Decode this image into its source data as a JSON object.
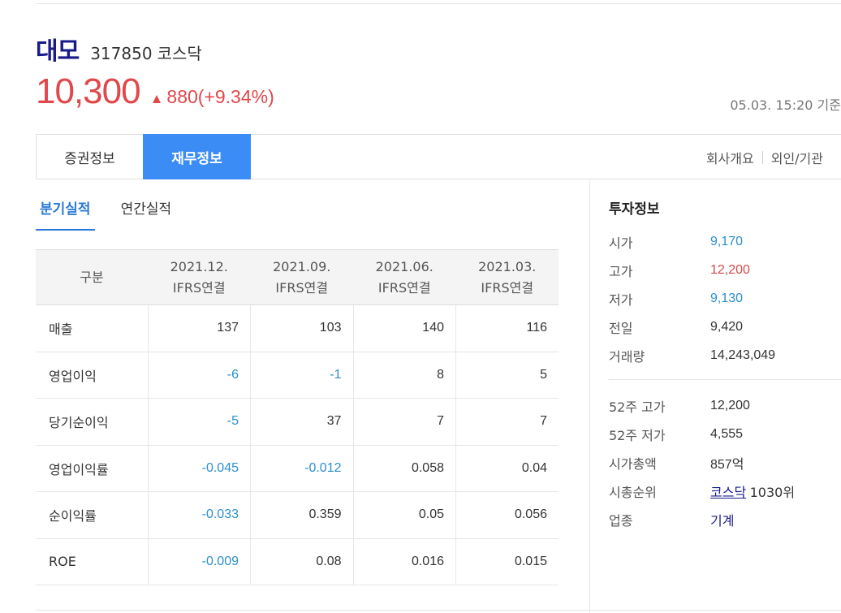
{
  "stock": {
    "name": "대모",
    "code": "317850",
    "market": "코스닥",
    "price": "10,300",
    "change_arrow": "▲",
    "change": "880(+9.34%)",
    "timestamp": "05.03. 15:20 기준"
  },
  "tabs": {
    "securities": "증권정보",
    "financial": "재무정보"
  },
  "links": {
    "company": "회사개요",
    "foreign": "외인/기관"
  },
  "subtabs": {
    "quarterly": "분기실적",
    "annual": "연간실적"
  },
  "table": {
    "header_label": "구분",
    "columns": [
      {
        "period": "2021.12.",
        "basis": "IFRS연결"
      },
      {
        "period": "2021.09.",
        "basis": "IFRS연결"
      },
      {
        "period": "2021.06.",
        "basis": "IFRS연결"
      },
      {
        "period": "2021.03.",
        "basis": "IFRS연결"
      }
    ],
    "rows": [
      {
        "label": "매출",
        "values": [
          "137",
          "103",
          "140",
          "116"
        ]
      },
      {
        "label": "영업이익",
        "values": [
          "-6",
          "-1",
          "8",
          "5"
        ]
      },
      {
        "label": "당기순이익",
        "values": [
          "-5",
          "37",
          "7",
          "7"
        ]
      },
      {
        "label": "영업이익률",
        "values": [
          "-0.045",
          "-0.012",
          "0.058",
          "0.04"
        ]
      },
      {
        "label": "순이익률",
        "values": [
          "-0.033",
          "0.359",
          "0.05",
          "0.056"
        ]
      },
      {
        "label": "ROE",
        "values": [
          "-0.009",
          "0.08",
          "0.016",
          "0.015"
        ]
      }
    ]
  },
  "invest": {
    "title": "투자정보",
    "open_label": "시가",
    "open": "9,170",
    "high_label": "고가",
    "high": "12,200",
    "low_label": "저가",
    "low": "9,130",
    "prev_label": "전일",
    "prev": "9,420",
    "volume_label": "거래량",
    "volume": "14,243,049",
    "w52_high_label": "52주 고가",
    "w52_high": "12,200",
    "w52_low_label": "52주 저가",
    "w52_low": "4,555",
    "mcap_label": "시가총액",
    "mcap": "857억",
    "rank_label": "시총순위",
    "rank_market": "코스닥",
    "rank": "1030위",
    "sector_label": "업종",
    "sector": "기계"
  },
  "colors": {
    "up": "#e0484b",
    "down": "#2b8fce",
    "accent": "#3b8cf5",
    "brand": "#1a1a8c"
  }
}
